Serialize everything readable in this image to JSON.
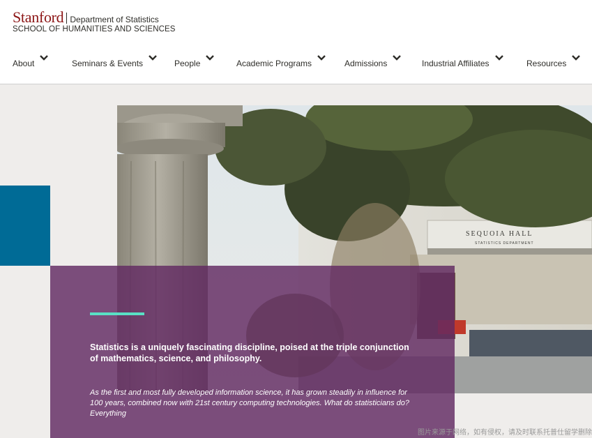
{
  "header": {
    "brand": "Stanford",
    "department": "Department of Statistics",
    "school": "SCHOOL OF HUMANITIES AND SCIENCES"
  },
  "nav": {
    "items": [
      {
        "label": "About",
        "icon": "chevron-down-icon"
      },
      {
        "label": "Seminars & Events",
        "icon": "chevron-down-icon"
      },
      {
        "label": "People",
        "icon": "chevron-down-icon"
      },
      {
        "label": "Academic Programs",
        "icon": "chevron-down-icon"
      },
      {
        "label": "Admissions",
        "icon": "chevron-down-icon"
      },
      {
        "label": "Industrial Affiliates",
        "icon": "chevron-down-icon"
      },
      {
        "label": "Resources",
        "icon": "chevron-down-icon"
      }
    ]
  },
  "hero": {
    "building_sign": "SEQUOIA HALL",
    "building_subsign": "STATISTICS   DEPARTMENT",
    "headline": "Statistics is a uniquely fascinating discipline, poised at the triple conjunction of mathematics, science, and philosophy.",
    "description": "As the first and most fully developed information science, it has grown steadily in influence for 100 years, combined now with 21st century computing technologies. What do statisticians do? Everything"
  },
  "watermark": "图片来源于网络，如有侵权，请及时联系托普仕留学删除",
  "colors": {
    "stanford_red": "#8c1515",
    "blue_block": "#006b96",
    "overlay_purple": "#622a62",
    "accent_teal": "#59e0c4",
    "page_bg": "#efedeb"
  }
}
